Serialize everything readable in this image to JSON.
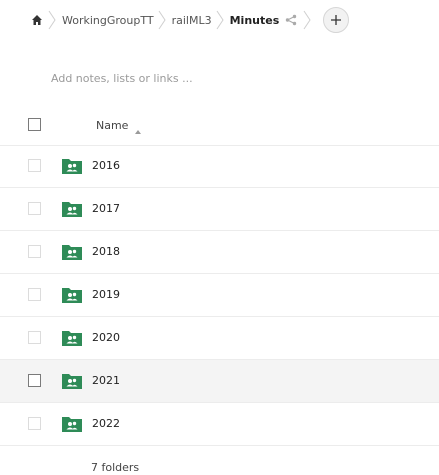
{
  "breadcrumb": {
    "home_icon": "home-icon",
    "items": [
      "WorkingGroupTT",
      "railML3",
      "Minutes"
    ],
    "share_icon": "share-icon",
    "add_label": "+"
  },
  "notes": {
    "placeholder": "Add notes, lists or links ..."
  },
  "table": {
    "header": {
      "name": "Name",
      "sort": "ascending"
    },
    "folder_color": "#2e8b57",
    "rows": [
      {
        "name": "2016",
        "selected": false
      },
      {
        "name": "2017",
        "selected": false
      },
      {
        "name": "2018",
        "selected": false
      },
      {
        "name": "2019",
        "selected": false
      },
      {
        "name": "2020",
        "selected": false
      },
      {
        "name": "2021",
        "selected": true
      },
      {
        "name": "2022",
        "selected": false
      }
    ]
  },
  "footer": {
    "summary": "7 folders"
  }
}
